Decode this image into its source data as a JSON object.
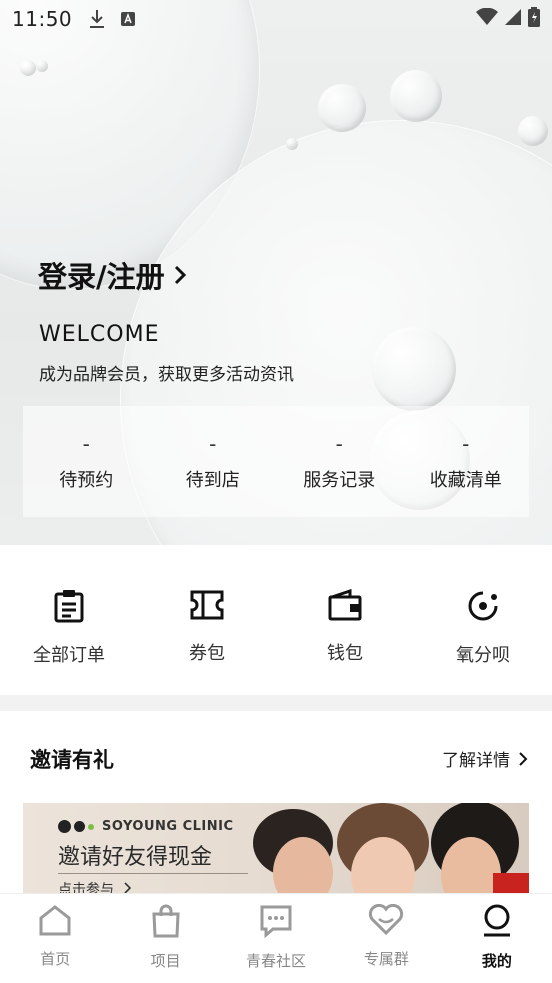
{
  "status_bar": {
    "time": "11:50",
    "icons": [
      "download-icon",
      "notification-a-icon",
      "wifi-icon",
      "signal-icon",
      "battery-icon"
    ]
  },
  "profile": {
    "login_label": "登录/注册",
    "welcome": "WELCOME",
    "member_text": "成为品牌会员，获取更多活动资讯"
  },
  "stats": [
    {
      "value": "-",
      "label": "待预约"
    },
    {
      "value": "-",
      "label": "待到店"
    },
    {
      "value": "-",
      "label": "服务记录"
    },
    {
      "value": "-",
      "label": "收藏清单"
    }
  ],
  "quick_actions": [
    {
      "label": "全部订单",
      "icon": "clipboard-icon"
    },
    {
      "label": "券包",
      "icon": "ticket-icon"
    },
    {
      "label": "钱包",
      "icon": "wallet-icon"
    },
    {
      "label": "氧分呗",
      "icon": "credit-icon"
    }
  ],
  "invite": {
    "title": "邀请有礼",
    "more_label": "了解详情",
    "banner": {
      "brand": "SOYOUNG CLINIC",
      "title": "邀请好友得现金",
      "cta": "点击参与"
    }
  },
  "bottom_nav": [
    {
      "label": "首页",
      "icon": "home-icon",
      "active": false
    },
    {
      "label": "项目",
      "icon": "bag-icon",
      "active": false
    },
    {
      "label": "青春社区",
      "icon": "chat-icon",
      "active": false
    },
    {
      "label": "专属群",
      "icon": "heart-icon",
      "active": false
    },
    {
      "label": "我的",
      "icon": "profile-icon",
      "active": true
    }
  ],
  "colors": {
    "brand_green": "#7bc043",
    "text_primary": "#111111",
    "text_inactive": "#888888"
  }
}
